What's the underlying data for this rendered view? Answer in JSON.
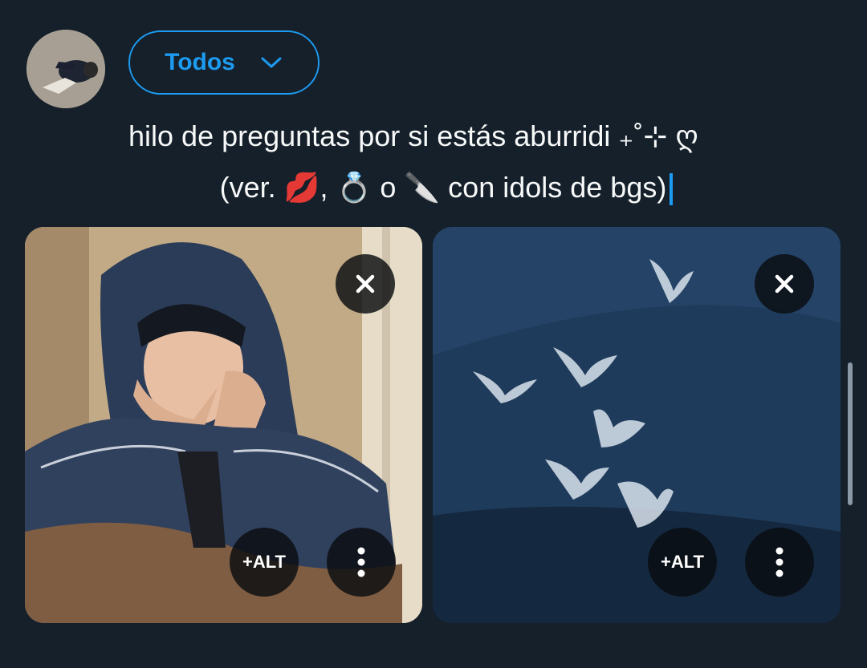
{
  "header": {
    "avatar_icon": "user-avatar",
    "audience_label": "Todos",
    "audience_icon": "chevron-down-icon"
  },
  "tweet": {
    "line1": "hilo de preguntas por si estás aburridi ₊˚⊹ ღ",
    "line2": "(ver. 💋, 💍 o 🔪 con idols de bgs)"
  },
  "media": [
    {
      "description_icon": "photo",
      "remove_icon": "close-icon",
      "alt_label": "+ALT",
      "more_icon": "vertical-dots-icon"
    },
    {
      "description_icon": "photo",
      "remove_icon": "close-icon",
      "alt_label": "+ALT",
      "more_icon": "vertical-dots-icon"
    }
  ],
  "colors": {
    "background": "#15202b",
    "accent": "#1d9bf0",
    "text": "#f7f9f9"
  }
}
